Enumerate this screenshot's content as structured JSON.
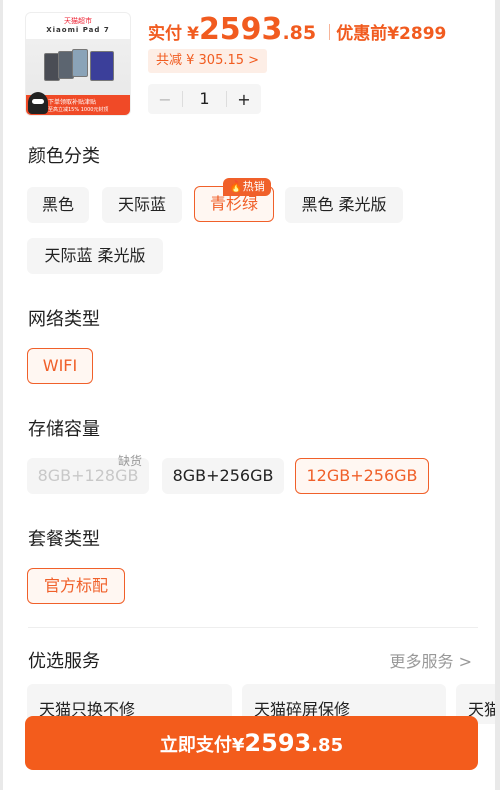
{
  "product": {
    "thumb_brand": "天猫超市",
    "thumb_model": "Xiaomi Pad 7",
    "thumb_strip_1": "下单领取补贴津贴",
    "thumb_strip_2": "至高立减15% 1000元封顶"
  },
  "price": {
    "label": "实付",
    "currency": "¥",
    "integer": "2593",
    "decimal": ".85",
    "original_label": "优惠前",
    "original": "¥2899",
    "discount": "共减 ¥ 305.15 >"
  },
  "quantity": {
    "minus": "−",
    "value": "1",
    "plus": "+"
  },
  "color": {
    "title": "颜色分类",
    "options": [
      "黑色",
      "天际蓝",
      "青杉绿",
      "黑色 柔光版",
      "天际蓝 柔光版"
    ],
    "hot_badge": "热销"
  },
  "network": {
    "title": "网络类型",
    "options": [
      "WIFI"
    ]
  },
  "storage": {
    "title": "存储容量",
    "options": [
      "8GB+128GB",
      "8GB+256GB",
      "12GB+256GB"
    ],
    "out_of_stock": "缺货"
  },
  "package": {
    "title": "套餐类型",
    "options": [
      "官方标配"
    ]
  },
  "services": {
    "title": "优选服务",
    "more": "更多服务 >",
    "items": [
      "天猫只换不修",
      "天猫碎屏保修",
      "天猫"
    ]
  },
  "pay_button": {
    "label": "立即支付",
    "currency": "¥",
    "integer": "2593",
    "decimal": ".85"
  },
  "colors": {
    "accent": "#f0602a",
    "pay_bg": "#f35c1c",
    "chip_bg": "#f5f5f5"
  }
}
